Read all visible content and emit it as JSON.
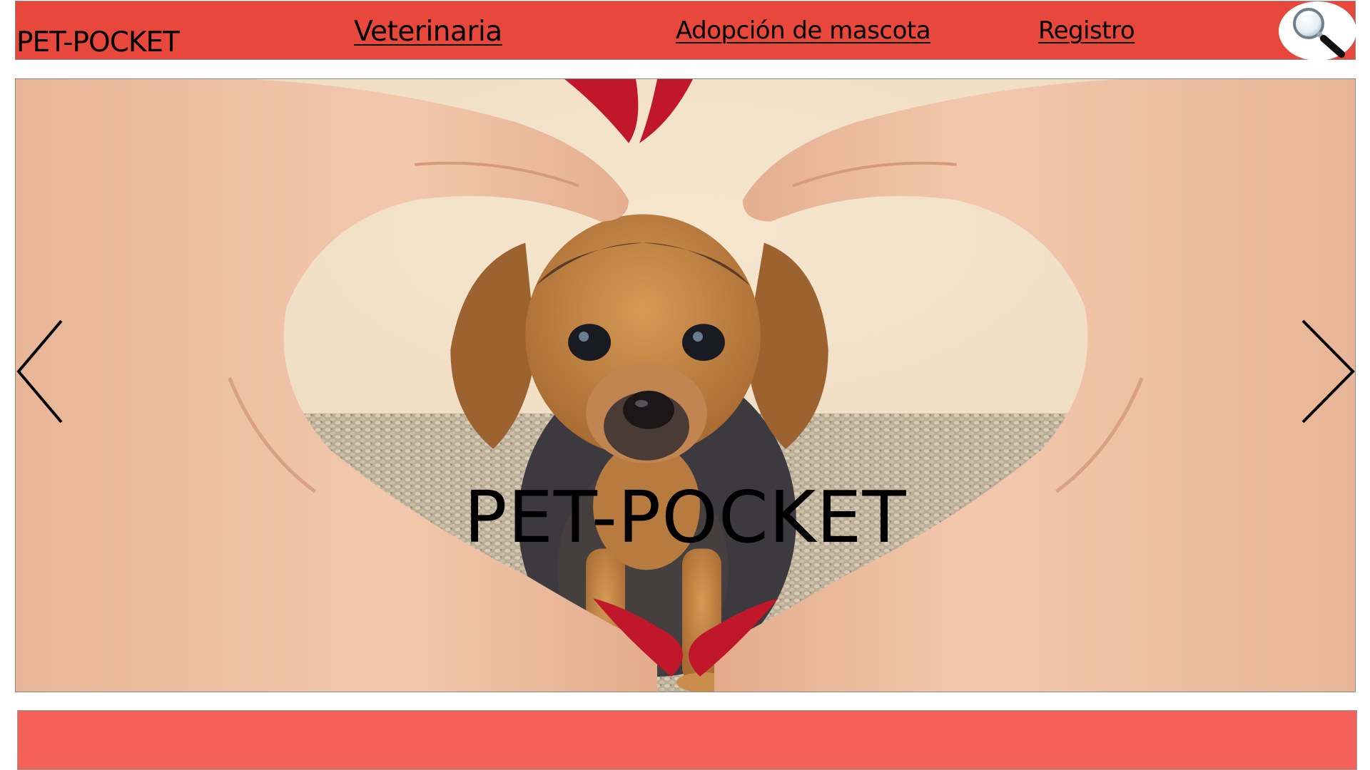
{
  "header": {
    "brand": "PET-POCKET",
    "nav": {
      "veterinaria": "Veterinaria ",
      "adopcion": "Adopción de mascota ",
      "registro": "Registro"
    },
    "search_icon": "magnifying-glass-icon"
  },
  "hero": {
    "title": "PET-POCKET",
    "image": "puppy-framed-by-heart-hands",
    "prev_icon": "chevron-left-icon",
    "next_icon": "chevron-right-icon"
  },
  "colors": {
    "header_bg": "#e8473c",
    "footer_bg": "#f4605a",
    "nail_polish": "#c0182a"
  }
}
